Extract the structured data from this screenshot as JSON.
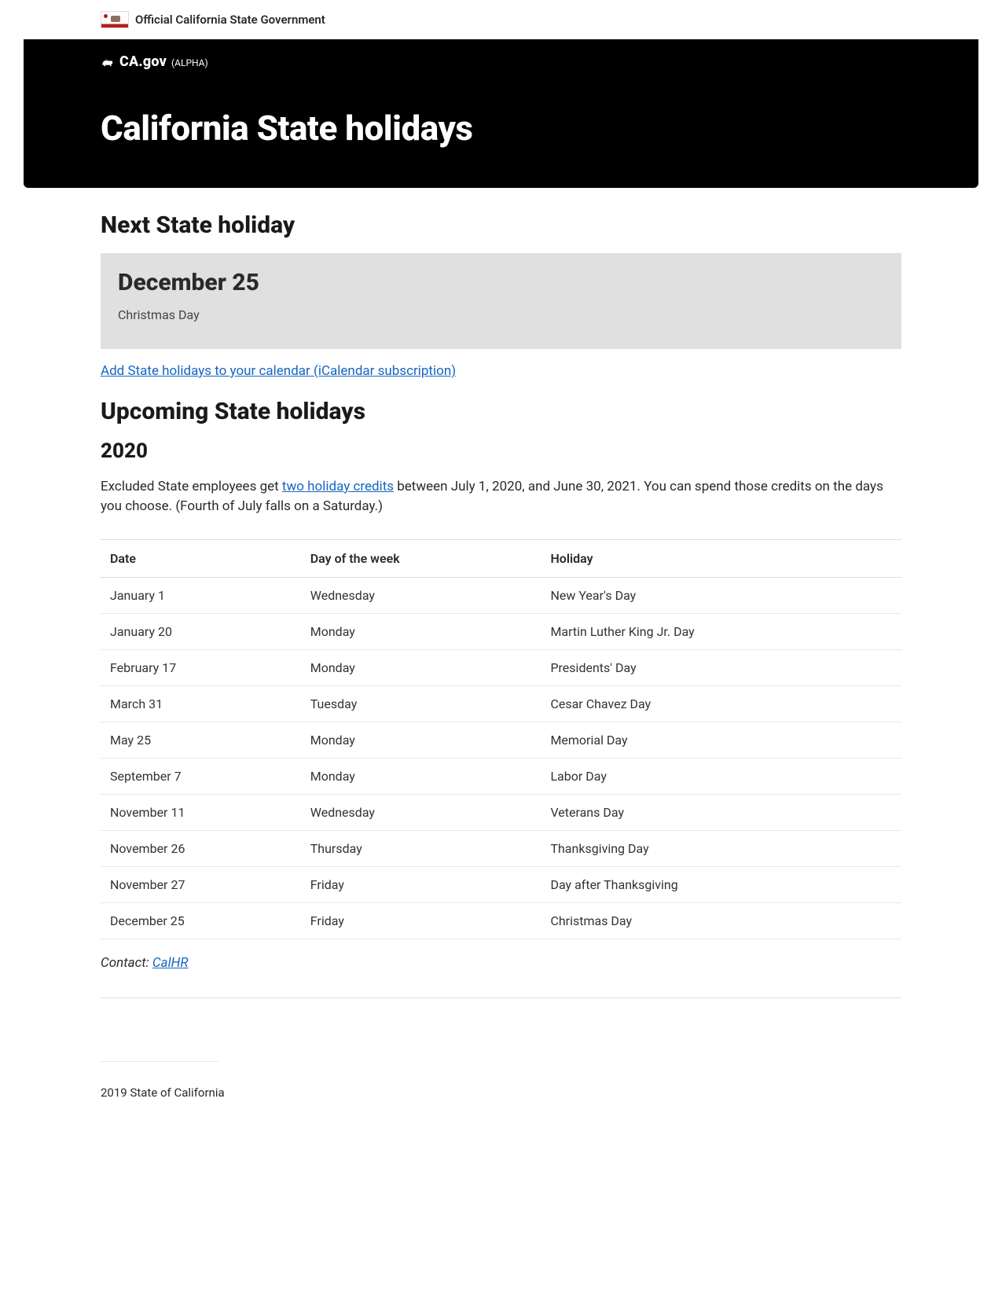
{
  "official_bar": {
    "text": "Official California State Government"
  },
  "header": {
    "site_name": "CA.gov",
    "alpha_tag": "(ALPHA)",
    "page_title": "California State holidays"
  },
  "next_holiday": {
    "heading": "Next State holiday",
    "date": "December 25",
    "name": "Christmas Day"
  },
  "calendar_link": "Add State holidays to your calendar (iCalendar subscription)",
  "upcoming": {
    "heading": "Upcoming State holidays",
    "year": "2020",
    "desc_before": "Excluded State employees get ",
    "desc_link": "two holiday credits",
    "desc_after": " between July 1, 2020, and June 30, 2021. You can spend those credits on the days you choose. (Fourth of July falls on a Saturday.)",
    "columns": [
      "Date",
      "Day of the week",
      "Holiday"
    ],
    "rows": [
      {
        "date": "January 1",
        "dow": "Wednesday",
        "holiday": "New Year's Day"
      },
      {
        "date": "January 20",
        "dow": "Monday",
        "holiday": "Martin Luther King Jr. Day"
      },
      {
        "date": "February 17",
        "dow": "Monday",
        "holiday": "Presidents' Day"
      },
      {
        "date": "March 31",
        "dow": "Tuesday",
        "holiday": "Cesar Chavez Day"
      },
      {
        "date": "May 25",
        "dow": "Monday",
        "holiday": "Memorial Day"
      },
      {
        "date": "September 7",
        "dow": "Monday",
        "holiday": "Labor Day"
      },
      {
        "date": "November 11",
        "dow": "Wednesday",
        "holiday": "Veterans Day"
      },
      {
        "date": "November 26",
        "dow": "Thursday",
        "holiday": "Thanksgiving Day"
      },
      {
        "date": "November 27",
        "dow": "Friday",
        "holiday": "Day after Thanksgiving"
      },
      {
        "date": "December 25",
        "dow": "Friday",
        "holiday": "Christmas Day"
      }
    ]
  },
  "contact": {
    "label": "Contact: ",
    "link_text": "CalHR"
  },
  "footer": {
    "copyright": "2019 State of California"
  }
}
